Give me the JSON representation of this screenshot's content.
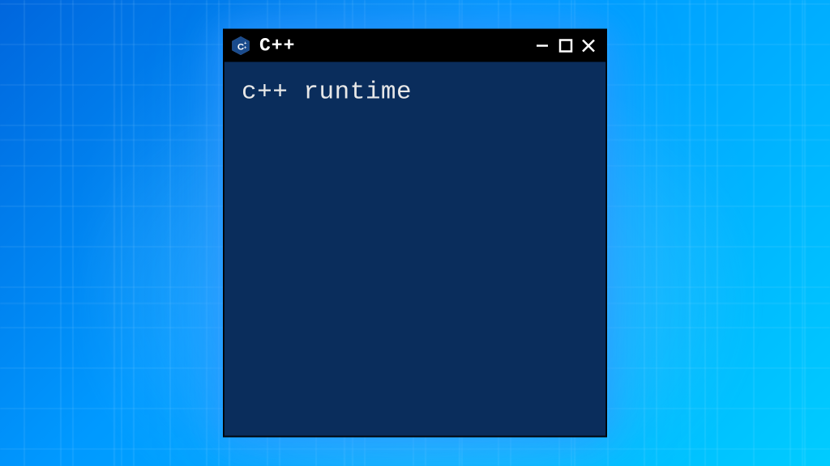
{
  "window": {
    "title": "C++",
    "icon_label": "C++"
  },
  "console": {
    "output": "c++ runtime"
  },
  "colors": {
    "console_bg": "#0a2d5c",
    "titlebar_bg": "#000000",
    "text": "#e8e8e8"
  }
}
